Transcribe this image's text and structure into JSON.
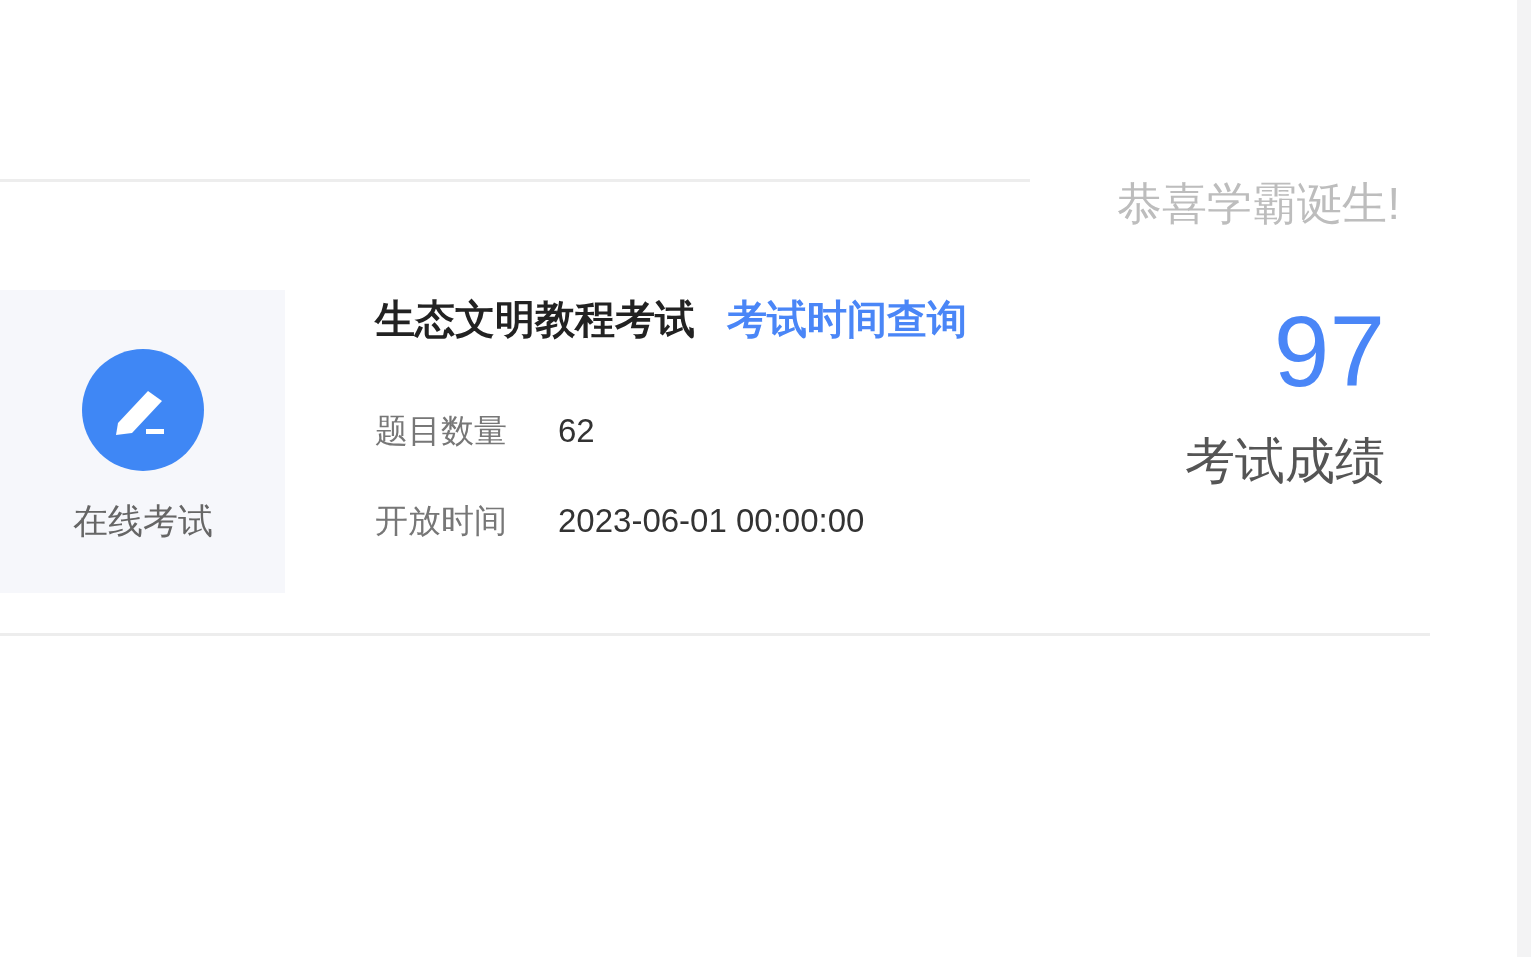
{
  "exam_card": {
    "module": {
      "label": "在线考试"
    },
    "title": "生态文明教程考试",
    "link": "考试时间查询",
    "fields": [
      {
        "label": "题目数量",
        "value": "62"
      },
      {
        "label": "开放时间",
        "value": "2023-06-01 00:00:00"
      }
    ],
    "result": {
      "message": "恭喜学霸诞生!",
      "score": "97",
      "score_label": "考试成绩"
    }
  }
}
